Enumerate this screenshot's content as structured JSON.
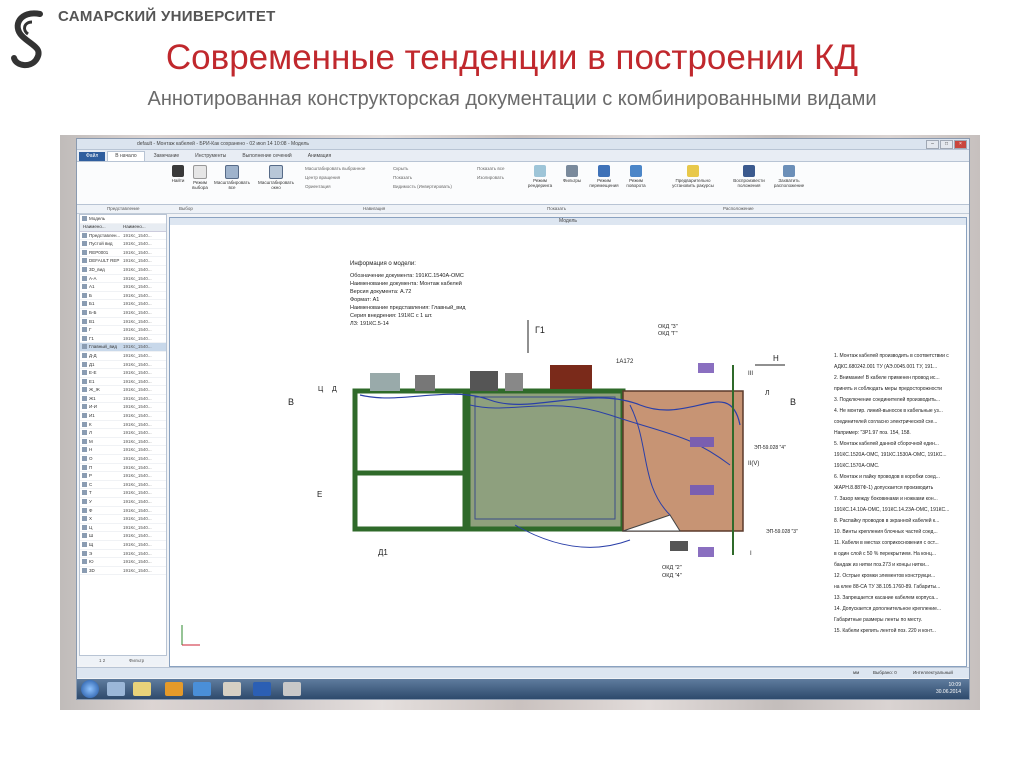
{
  "header": {
    "university": "САМАРСКИЙ УНИВЕРСИТЕТ",
    "title": "Современные тенденции в построении КД",
    "subtitle": "Аннотированная конструкторская документации с комбинированными видами"
  },
  "window": {
    "title": "default - Монтаж кабелей - БРИ-Как сохранено - 02 июл 14 10:08 - Модель"
  },
  "tabs": [
    "Файл",
    "В начало",
    "Замечание",
    "Инструменты",
    "Выполнение сечений",
    "Анимация"
  ],
  "ribbon": {
    "buttons": [
      "Найти",
      "Режим выбора",
      "Масштабировать все",
      "Масштабировать окно",
      "Режим рендеринга",
      "Фильтры",
      "Режим перемещения",
      "Режим поворота",
      "Предварительно установить ракурсы",
      "Воспроизвести положения",
      "Захватить расположение"
    ],
    "small_items": [
      "Масштабировать выбранное",
      "Центр вращения",
      "Ориентация",
      "Скрыть",
      "Показать",
      "Видимость (Инвертировать)",
      "Показать все",
      "Изолировать"
    ],
    "groups": [
      "Представление",
      "Выбор",
      "Навигация",
      "Показать",
      "Расположение"
    ]
  },
  "tree": {
    "root": "Модель",
    "columns": [
      "Наимено...",
      "Наимено..."
    ],
    "rows": [
      {
        "name": "Представлен...",
        "value": "191Кс_1540..."
      },
      {
        "name": "Пустой вид",
        "value": "191Кс_1540..."
      },
      {
        "name": "REP0001",
        "value": "191Кс_1540..."
      },
      {
        "name": "DEFAULT REP",
        "value": "191Кс_1540..."
      },
      {
        "name": "3D_вид",
        "value": "191Кс_1540..."
      },
      {
        "name": "А-А",
        "value": "191Кс_1540..."
      },
      {
        "name": "А1",
        "value": "191Кс_1540..."
      },
      {
        "name": "Б",
        "value": "191Кс_1540..."
      },
      {
        "name": "Б1",
        "value": "191Кс_1540..."
      },
      {
        "name": "Б-Б",
        "value": "191Кс_1540..."
      },
      {
        "name": "В1",
        "value": "191Кс_1540..."
      },
      {
        "name": "Г",
        "value": "191Кс_1540..."
      },
      {
        "name": "Г1",
        "value": "191Кс_1540..."
      },
      {
        "name": "Главный_вид",
        "value": "191Кс_1540...",
        "selected": true
      },
      {
        "name": "Д-Д",
        "value": "191Кс_1540..."
      },
      {
        "name": "Д1",
        "value": "191Кс_1540..."
      },
      {
        "name": "Е-Е",
        "value": "191Кс_1540..."
      },
      {
        "name": "Е1",
        "value": "191Кс_1540..."
      },
      {
        "name": "Ж_Ж",
        "value": "191Кс_1540..."
      },
      {
        "name": "Ж1",
        "value": "191Кс_1540..."
      },
      {
        "name": "И-И",
        "value": "191Кс_1540..."
      },
      {
        "name": "И1",
        "value": "191Кс_1540..."
      },
      {
        "name": "К",
        "value": "191Кс_1540..."
      },
      {
        "name": "Л",
        "value": "191Кс_1540..."
      },
      {
        "name": "М",
        "value": "191Кс_1540..."
      },
      {
        "name": "Н",
        "value": "191Кс_1540..."
      },
      {
        "name": "О",
        "value": "191Кс_1540..."
      },
      {
        "name": "П",
        "value": "191Кс_1540..."
      },
      {
        "name": "Р",
        "value": "191Кс_1540..."
      },
      {
        "name": "С",
        "value": "191Кс_1540..."
      },
      {
        "name": "Т",
        "value": "191Кс_1540..."
      },
      {
        "name": "У",
        "value": "191Кс_1540..."
      },
      {
        "name": "Ф",
        "value": "191Кс_1540..."
      },
      {
        "name": "Х",
        "value": "191Кс_1540..."
      },
      {
        "name": "Ц",
        "value": "191Кс_1540..."
      },
      {
        "name": "Ш",
        "value": "191Кс_1540..."
      },
      {
        "name": "Щ",
        "value": "191Кс_1540..."
      },
      {
        "name": "Э",
        "value": "191Кс_1540..."
      },
      {
        "name": "Ю",
        "value": "191Кс_1540..."
      },
      {
        "name": "3D",
        "value": "191Кс_1540..."
      }
    ],
    "footer_pages": "1 2",
    "footer_label": "Фильтр"
  },
  "canvas": {
    "header": "Модель",
    "info_title": "Информация о модели:",
    "info_lines": [
      "Обозначение документа: 191КС.1540А-ОМС",
      "Наименование документа: Монтаж кабелей",
      "Версия документа: А.72",
      "Формат: А1",
      "Наименование представления: Главный_вид",
      "Серия внедрения: 191КС с 1 шт.",
      "ЛЗ: 191КС.5-14"
    ],
    "labels": {
      "g1": "Г1",
      "d1": "Д1",
      "a172": "1А172",
      "n": "Н",
      "v": "В",
      "e": "Е",
      "ce": "Ц",
      "d": "Д",
      "l": "Л",
      "ii": "II(V)",
      "iii": "III",
      "i": "I",
      "okd3": "ОКД \"3\"",
      "okd2": "ОКД \"Г\"",
      "okd5": "ОКД \"2\"",
      "okd6": "ОКД \"4\"",
      "ep1": "ЭП-59.028 \"4\"",
      "ep2": "ЭП-59.028 \"3\""
    },
    "notes": [
      "1. Монтаж кабелей производить в соответствии с",
      "АДКС.680242.001 ТУ (АЭ.0045.001 ТУ, 191...",
      "2. Внимание! В кабеле применен провод ис...",
      "принять и соблюдать меры предосторожности",
      "3. Подключение соединителей производить...",
      "4. Не монтир. линий-выносок в кабельные уз...",
      "соединителей согласно электрической схе...",
      "Например: \"3Р1.97 поз. 154, 158.",
      "5. Монтаж кабелей данной сборочной един...",
      "191КС.1520А-ОМС, 191КС.1530А-ОМС, 191КС...",
      "191КС.1570А-ОМС.",
      "6. Монтаж и пайку проводов в коробки соед...",
      "ЖАРН.8.887Ф-1) допускается производить",
      "7. Зазор между боковинами и ножками кон...",
      "191КС.14.10А-ОМС, 191КС.14.23А-ОМС, 191КС...",
      "8. Распайку проводов в экранной кабелей к...",
      "10. Винты крепления блочных частей соед...",
      "11. Кабели в местах соприкосновения с ост...",
      "в один слой с 50 % перекрытием. На конц...",
      "бандаж из нитки поз.273 и концы нитки...",
      "12. Острые кромки элементов конструкци...",
      "на клее 88-СА ТУ 38.105.1760-89. Габариты...",
      "13. Запрещается касание кабелем корпуса...",
      "14. Допускается дополнительное крепление...",
      "Габаритные размеры ленты по месту.",
      "15. Кабели крепить лентой поз. 220 и конт..."
    ]
  },
  "statusbar": {
    "left": "",
    "unit": "мм",
    "selected": "Выбрано: 0",
    "mode": "Интеллектуальный"
  },
  "taskbar": {
    "time": "10:09",
    "date": "30.06.2014"
  },
  "colors": {
    "title_red": "#c0282d",
    "frame_green": "#2f6a2a",
    "panel_brown": "#c79474",
    "wiring_blue": "#2a3fa8"
  }
}
